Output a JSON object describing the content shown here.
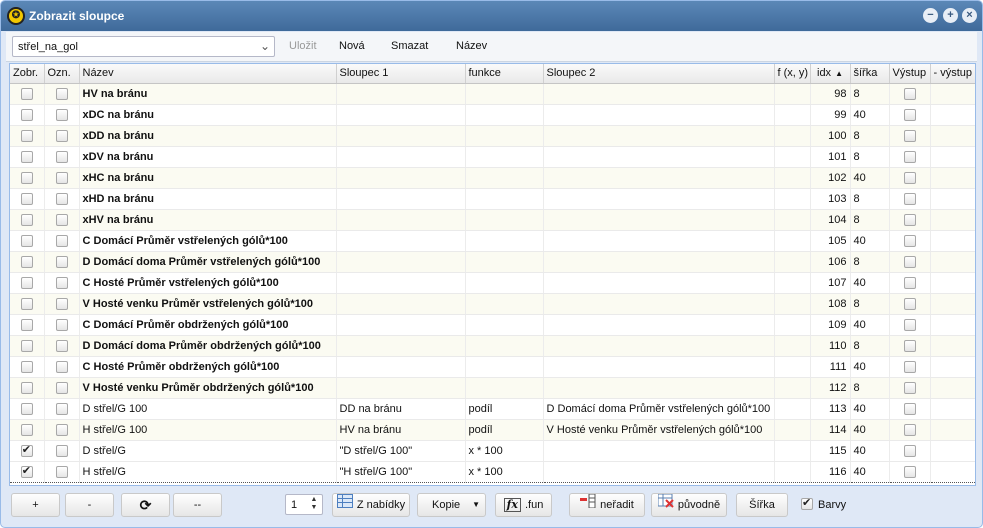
{
  "window": {
    "title": "Zobrazit sloupce"
  },
  "toolbar": {
    "combo_value": "střel_na_gol",
    "save_label": "Uložit",
    "new_label": "Nová",
    "delete_label": "Smazat",
    "name_label": "Název"
  },
  "columns": {
    "zobr": "Zobr.",
    "ozn": "Ozn.",
    "nazev": "Název",
    "sloupec1": "Sloupec 1",
    "funkce": "funkce",
    "sloupec2": "Sloupec 2",
    "fxy": "f (x, y)",
    "idx": "idx",
    "sirka": "šířka",
    "vystup": "Výstup",
    "minus_vystup": "- výstup"
  },
  "rows": [
    {
      "zobr": false,
      "ozn": false,
      "nazev": "HV na bránu",
      "bold": true,
      "sloupec1": "",
      "funkce": "",
      "sloupec2": "",
      "fxy": "",
      "idx": "98",
      "sirka": "8",
      "vystup": false
    },
    {
      "zobr": false,
      "ozn": false,
      "nazev": "xDC na bránu",
      "bold": true,
      "sloupec1": "",
      "funkce": "",
      "sloupec2": "",
      "fxy": "",
      "idx": "99",
      "sirka": "40",
      "vystup": false
    },
    {
      "zobr": false,
      "ozn": false,
      "nazev": "xDD na bránu",
      "bold": true,
      "sloupec1": "",
      "funkce": "",
      "sloupec2": "",
      "fxy": "",
      "idx": "100",
      "sirka": "8",
      "vystup": false
    },
    {
      "zobr": false,
      "ozn": false,
      "nazev": "xDV na bránu",
      "bold": true,
      "sloupec1": "",
      "funkce": "",
      "sloupec2": "",
      "fxy": "",
      "idx": "101",
      "sirka": "8",
      "vystup": false
    },
    {
      "zobr": false,
      "ozn": false,
      "nazev": "xHC na bránu",
      "bold": true,
      "sloupec1": "",
      "funkce": "",
      "sloupec2": "",
      "fxy": "",
      "idx": "102",
      "sirka": "40",
      "vystup": false
    },
    {
      "zobr": false,
      "ozn": false,
      "nazev": "xHD na bránu",
      "bold": true,
      "sloupec1": "",
      "funkce": "",
      "sloupec2": "",
      "fxy": "",
      "idx": "103",
      "sirka": "8",
      "vystup": false
    },
    {
      "zobr": false,
      "ozn": false,
      "nazev": "xHV na bránu",
      "bold": true,
      "sloupec1": "",
      "funkce": "",
      "sloupec2": "",
      "fxy": "",
      "idx": "104",
      "sirka": "8",
      "vystup": false
    },
    {
      "zobr": false,
      "ozn": false,
      "nazev": "C Domácí Průměr vstřelených gólů*100",
      "bold": true,
      "sloupec1": "",
      "funkce": "",
      "sloupec2": "",
      "fxy": "",
      "idx": "105",
      "sirka": "40",
      "vystup": false
    },
    {
      "zobr": false,
      "ozn": false,
      "nazev": "D Domácí doma Průměr vstřelených gólů*100",
      "bold": true,
      "sloupec1": "",
      "funkce": "",
      "sloupec2": "",
      "fxy": "",
      "idx": "106",
      "sirka": "8",
      "vystup": false
    },
    {
      "zobr": false,
      "ozn": false,
      "nazev": "C Hosté Průměr vstřelených gólů*100",
      "bold": true,
      "sloupec1": "",
      "funkce": "",
      "sloupec2": "",
      "fxy": "",
      "idx": "107",
      "sirka": "40",
      "vystup": false
    },
    {
      "zobr": false,
      "ozn": false,
      "nazev": "V Hosté venku Průměr vstřelených gólů*100",
      "bold": true,
      "sloupec1": "",
      "funkce": "",
      "sloupec2": "",
      "fxy": "",
      "idx": "108",
      "sirka": "8",
      "vystup": false
    },
    {
      "zobr": false,
      "ozn": false,
      "nazev": "C Domácí Průměr obdržených gólů*100",
      "bold": true,
      "sloupec1": "",
      "funkce": "",
      "sloupec2": "",
      "fxy": "",
      "idx": "109",
      "sirka": "40",
      "vystup": false
    },
    {
      "zobr": false,
      "ozn": false,
      "nazev": "D Domácí doma Průměr obdržených gólů*100",
      "bold": true,
      "sloupec1": "",
      "funkce": "",
      "sloupec2": "",
      "fxy": "",
      "idx": "110",
      "sirka": "8",
      "vystup": false
    },
    {
      "zobr": false,
      "ozn": false,
      "nazev": "C Hosté Průměr obdržených gólů*100",
      "bold": true,
      "sloupec1": "",
      "funkce": "",
      "sloupec2": "",
      "fxy": "",
      "idx": "111",
      "sirka": "40",
      "vystup": false
    },
    {
      "zobr": false,
      "ozn": false,
      "nazev": "V Hosté venku Průměr obdržených gólů*100",
      "bold": true,
      "sloupec1": "",
      "funkce": "",
      "sloupec2": "",
      "fxy": "",
      "idx": "112",
      "sirka": "8",
      "vystup": false
    },
    {
      "zobr": false,
      "ozn": false,
      "nazev": "D střel/G 100",
      "bold": false,
      "sloupec1": "DD na bránu",
      "funkce": "podíl",
      "sloupec2": "D Domácí doma Průměr vstřelených gólů*100",
      "fxy": "",
      "idx": "113",
      "sirka": "40",
      "vystup": false
    },
    {
      "zobr": false,
      "ozn": false,
      "nazev": "H střel/G 100",
      "bold": false,
      "sloupec1": "HV na bránu",
      "funkce": "podíl",
      "sloupec2": "V Hosté venku Průměr vstřelených gólů*100",
      "fxy": "",
      "idx": "114",
      "sirka": "40",
      "vystup": false
    },
    {
      "zobr": true,
      "ozn": false,
      "nazev": "D střel/G",
      "bold": false,
      "sloupec1": "\"D střel/G 100\"",
      "funkce": "x * 100",
      "sloupec2": "",
      "fxy": "",
      "idx": "115",
      "sirka": "40",
      "vystup": false
    },
    {
      "zobr": true,
      "ozn": false,
      "nazev": "H střel/G",
      "bold": false,
      "sloupec1": "\"H střel/G 100\"",
      "funkce": "x * 100",
      "sloupec2": "",
      "fxy": "",
      "idx": "116",
      "sirka": "40",
      "vystup": false,
      "selected": true
    }
  ],
  "bottom": {
    "add_label": "+",
    "remove_label": "-",
    "refresh_icon": "refresh-icon",
    "dash_label": "--",
    "page_value": "1",
    "from_menu_label": "Z nabídky",
    "copy_label": "Kopie",
    "fun_label": ".fun",
    "unsort_label": "neřadit",
    "original_label": "původně",
    "width_label": "Šířka",
    "colors_label": "Barvy",
    "colors_checked": true
  },
  "colors": {
    "title_bar": "#4a77a8",
    "row_alt": "#fbfbf2",
    "accent": "#3f6a9a"
  }
}
